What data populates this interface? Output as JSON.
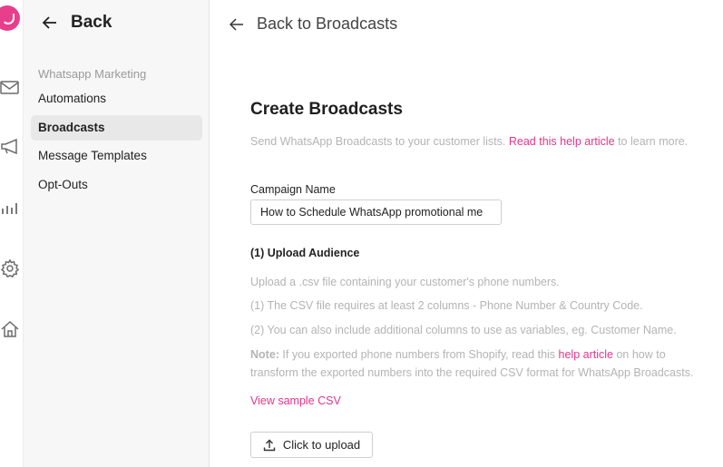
{
  "sidebar": {
    "back_label": "Back",
    "section_label": "Whatsapp Marketing",
    "items": [
      {
        "label": "Automations"
      },
      {
        "label": "Broadcasts"
      },
      {
        "label": "Message Templates"
      },
      {
        "label": "Opt-Outs"
      }
    ],
    "active_item": "Broadcasts"
  },
  "header": {
    "back_label": "Back to Broadcasts"
  },
  "main": {
    "title": "Create Broadcasts",
    "subtitle_pre": "Send WhatsApp Broadcasts to your customer lists. ",
    "subtitle_link": "Read this help article",
    "subtitle_post": " to learn more.",
    "campaign_label": "Campaign Name",
    "campaign_value": "How to Schedule WhatsApp promotional me",
    "upload_section_title": "(1) Upload Audience",
    "hint_1": "Upload a .csv file containing your customer's phone numbers.",
    "hint_2": "(1) The CSV file requires at least 2 columns - Phone Number & Country Code.",
    "hint_3": "(2) You can also include additional columns to use as variables, eg. Customer Name.",
    "note_label": "Note:",
    "note_pre": " If you exported phone numbers from Shopify, read this ",
    "note_link": "help article",
    "note_post": " on how to",
    "note_line2": "transform the exported numbers into the required CSV format for WhatsApp Broadcasts.",
    "sample_link": "View sample CSV",
    "upload_button": "Click to upload"
  },
  "colors": {
    "accent": "#e8348a",
    "muted_text": "#b4b4b4",
    "sidebar_bg": "#f7f7f7",
    "active_bg": "#e8e8e8"
  },
  "icons": {
    "rail": [
      "logo-icon",
      "mail-icon",
      "megaphone-icon",
      "chart-icon",
      "gear-icon",
      "home-icon"
    ]
  }
}
